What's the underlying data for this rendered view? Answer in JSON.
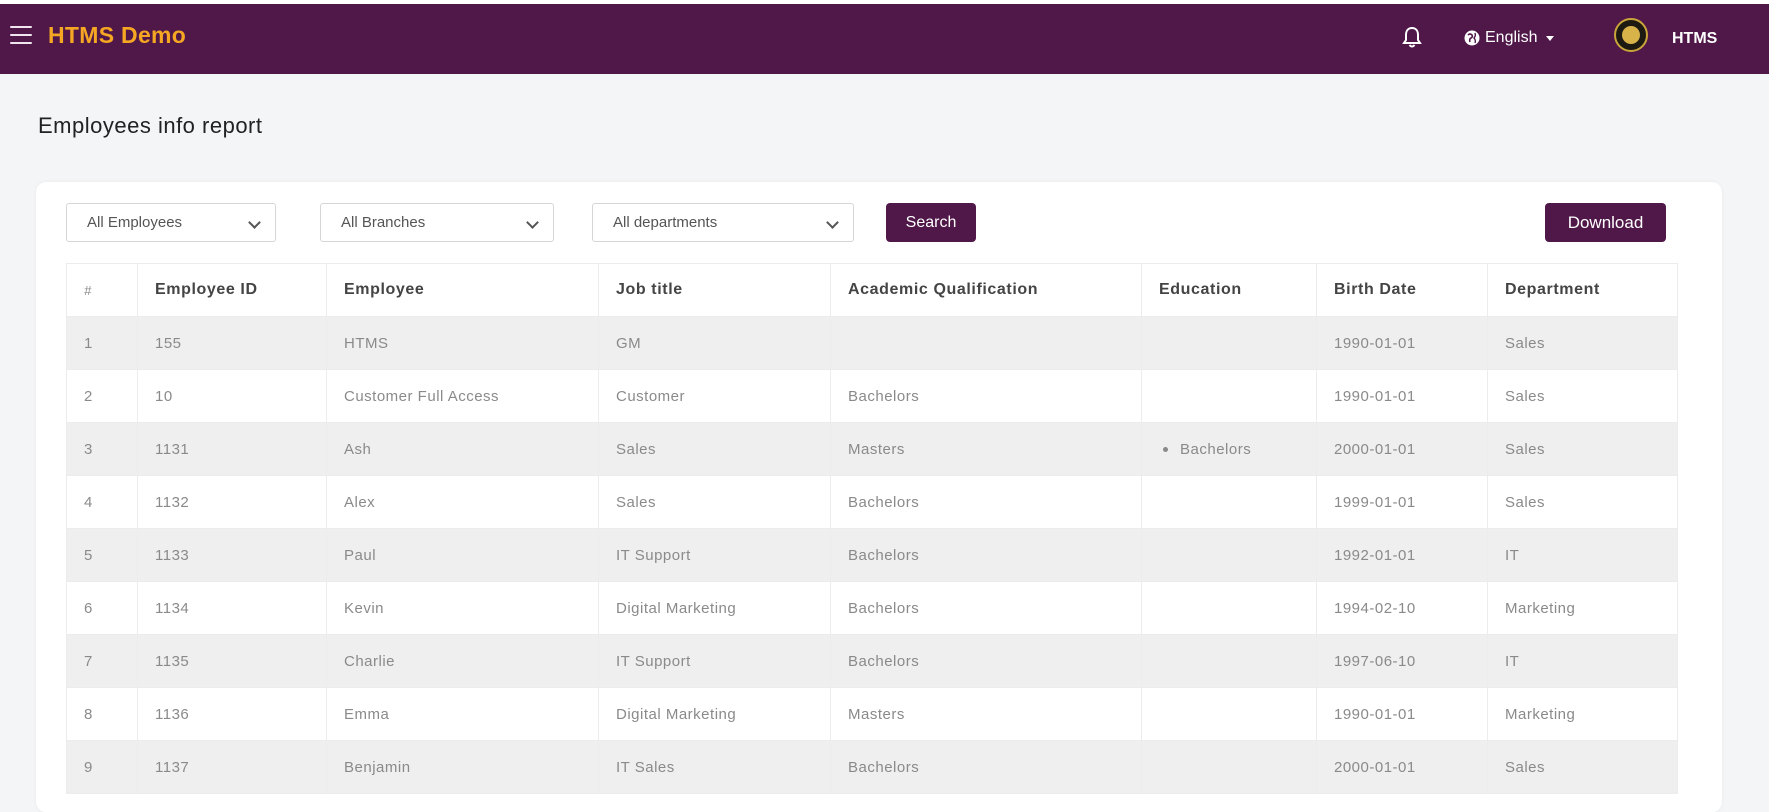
{
  "app": {
    "brand": "HTMS Demo",
    "language": "English",
    "user": "HTMS",
    "icons": [
      "menu-icon",
      "bell-icon",
      "globe-icon",
      "avatar-logo"
    ],
    "colors": {
      "header": "#4f1848",
      "brand": "#f5a623",
      "button": "#4f1848"
    }
  },
  "page": {
    "title": "Employees info report"
  },
  "filters": {
    "employees": "All Employees",
    "branches": "All Branches",
    "departments": "All departments",
    "search_label": "Search",
    "download_label": "Download"
  },
  "table": {
    "headers": [
      "#",
      "Employee ID",
      "Employee",
      "Job title",
      "Academic Qualification",
      "Education",
      "Birth Date",
      "Department"
    ],
    "rows": [
      [
        "1",
        "155",
        "HTMS",
        "GM",
        "",
        "",
        "1990-01-01",
        "Sales"
      ],
      [
        "2",
        "10",
        "Customer Full Access",
        "Customer",
        "Bachelors",
        "",
        "1990-01-01",
        "Sales"
      ],
      [
        "3",
        "1131",
        "Ash",
        "Sales",
        "Masters",
        "Bachelors",
        "2000-01-01",
        "Sales"
      ],
      [
        "4",
        "1132",
        "Alex",
        "Sales",
        "Bachelors",
        "",
        "1999-01-01",
        "Sales"
      ],
      [
        "5",
        "1133",
        "Paul",
        "IT Support",
        "Bachelors",
        "",
        "1992-01-01",
        "IT"
      ],
      [
        "6",
        "1134",
        "Kevin",
        "Digital Marketing",
        "Bachelors",
        "",
        "1994-02-10",
        "Marketing"
      ],
      [
        "7",
        "1135",
        "Charlie",
        "IT Support",
        "Bachelors",
        "",
        "1997-06-10",
        "IT"
      ],
      [
        "8",
        "1136",
        "Emma",
        "Digital Marketing",
        "Masters",
        "",
        "1990-01-01",
        "Marketing"
      ],
      [
        "9",
        "1137",
        "Benjamin",
        "IT Sales",
        "Bachelors",
        "",
        "2000-01-01",
        "Sales"
      ]
    ]
  }
}
